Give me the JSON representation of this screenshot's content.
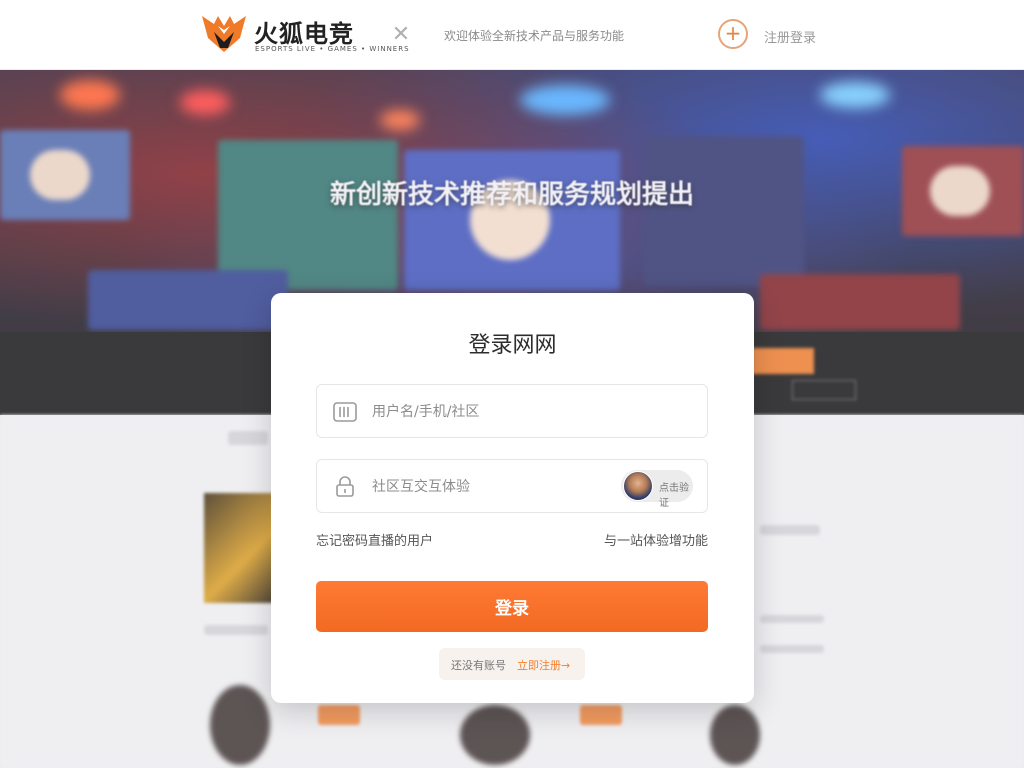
{
  "header": {
    "brand_name": "火狐电竞",
    "brand_sub": "ESPORTS LIVE • GAMES • WINNERS",
    "tagline": "欢迎体验全新技术产品与服务功能",
    "action_link": "注册登录"
  },
  "hero": {
    "title": "新创新技术推荐和服务规划提出"
  },
  "login": {
    "title": "登录网网",
    "username_placeholder": "用户名/手机/社区",
    "password_placeholder": "社区互交互体验",
    "captcha_label": "点击验证",
    "link_left": "忘记密码直播的用户",
    "link_right": "与一站体验增功能",
    "submit_label": "登录",
    "footer_label": "还没有账号",
    "footer_link": "立即注册→"
  },
  "colors": {
    "accent": "#f26a22",
    "accent_light": "#ff7a35",
    "text_dark": "#2d2d2d"
  },
  "icons": [
    "fox-logo-icon",
    "close-icon",
    "plus-icon",
    "user-icon",
    "lock-icon",
    "captcha-avatar"
  ]
}
